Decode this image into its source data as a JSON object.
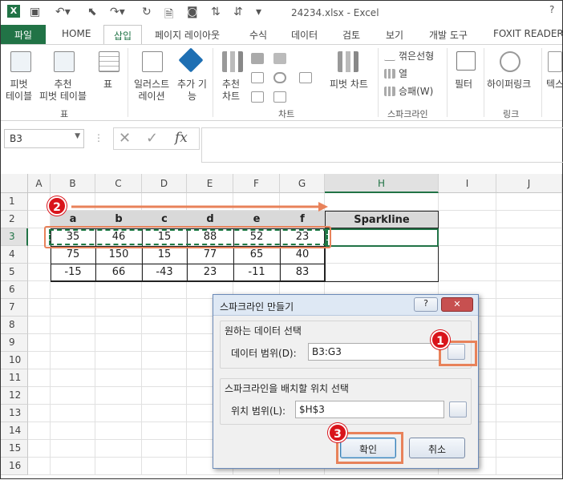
{
  "window": {
    "title": "24234.xlsx - Excel"
  },
  "tabs": [
    "파일",
    "HOME",
    "삽입",
    "페이지 레이아웃",
    "수식",
    "데이터",
    "검토",
    "보기",
    "개발 도구",
    "FOXIT READER P"
  ],
  "ribbon": {
    "pivot_table": "피벗\n테이블",
    "recommended_pivot": "추천\n피벗 테이블",
    "table": "표",
    "illustrations": "일러스트\n레이션",
    "addins": "추가 기\n능",
    "recommended_charts": "추천\n차트",
    "pivot_chart": "피벗 차트",
    "spark_line": "꺾은선형",
    "spark_column": "열",
    "spark_winloss": "승패(W)",
    "filter": "필터",
    "hyperlink": "하이퍼링크",
    "text": "텍스",
    "group_table": "표",
    "group_charts": "차트",
    "group_sparklines": "스파크라인",
    "group_links": "링크"
  },
  "formula_bar": {
    "namebox": "B3",
    "fx": "fx",
    "formula": ""
  },
  "grid": {
    "columns": [
      "A",
      "B",
      "C",
      "D",
      "E",
      "F",
      "G",
      "H",
      "I",
      "J"
    ],
    "rows": [
      "1",
      "2",
      "3",
      "4",
      "5",
      "6",
      "7",
      "8",
      "9",
      "10",
      "11",
      "12",
      "13",
      "14",
      "15",
      "16"
    ],
    "headers": [
      "a",
      "b",
      "c",
      "d",
      "e",
      "f"
    ],
    "h2": "Sparkline",
    "data": [
      [
        "35",
        "46",
        "15",
        "88",
        "52",
        "23"
      ],
      [
        "75",
        "150",
        "15",
        "77",
        "65",
        "40"
      ],
      [
        "-15",
        "66",
        "-43",
        "23",
        "-11",
        "83"
      ]
    ]
  },
  "dialog": {
    "title": "스파크라인 만들기",
    "help": "?",
    "section1": "원하는 데이터 선택",
    "data_range_label": "데이터 범위(D):",
    "data_range_value": "B3:G3",
    "section2": "스파크라인을 배치할 위치 선택",
    "location_label": "위치 범위(L):",
    "location_value": "$H$3",
    "ok": "확인",
    "cancel": "취소"
  },
  "callouts": [
    "1",
    "2",
    "3"
  ],
  "colors": {
    "excel_green": "#217346",
    "callout_red": "#d9141b",
    "callout_orange": "#e8825a"
  }
}
